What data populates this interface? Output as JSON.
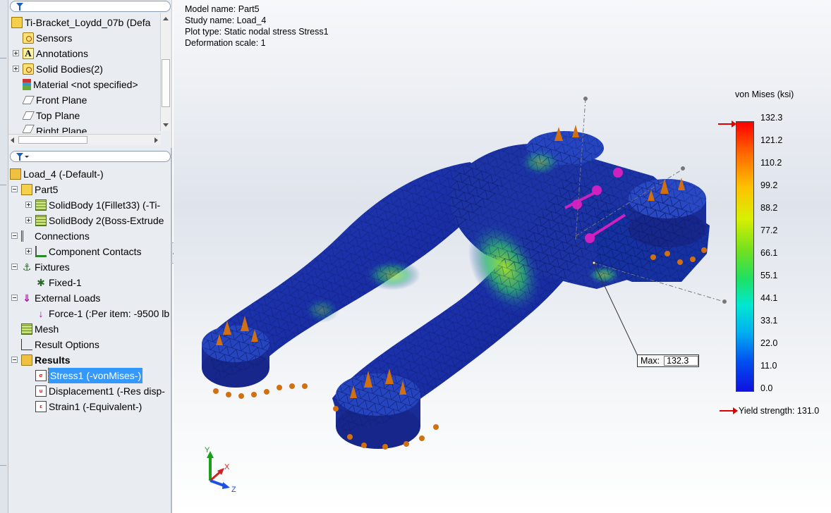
{
  "feature_tree": {
    "root_label": "Ti-Bracket_Loydd_07b  (Defa",
    "items": [
      {
        "label": "Sensors",
        "icon": "sensors-icon"
      },
      {
        "label": "Annotations",
        "icon": "annotations-icon"
      },
      {
        "label": "Solid Bodies(2)",
        "icon": "solid-bodies-icon"
      },
      {
        "label": "Material <not specified>",
        "icon": "material-icon"
      },
      {
        "label": "Front Plane",
        "icon": "plane-icon"
      },
      {
        "label": "Top Plane",
        "icon": "plane-icon"
      },
      {
        "label": "Right Plane",
        "icon": "plane-icon"
      }
    ]
  },
  "study_tree": {
    "root_label": "Load_4 (-Default-)",
    "part_label": "Part5",
    "solid_body_1": "SolidBody 1(Fillet33) (-Ti-",
    "solid_body_2": "SolidBody 2(Boss-Extrude",
    "connections": "Connections",
    "component_contacts": "Component Contacts",
    "fixtures": "Fixtures",
    "fixed_1": "Fixed-1",
    "external_loads": "External Loads",
    "force_1": "Force-1 (:Per item: -9500 lb",
    "mesh": "Mesh",
    "result_options": "Result Options",
    "results": "Results",
    "stress_1": "Stress1 (-vonMises-)",
    "displacement_1": "Displacement1 (-Res disp-",
    "strain_1": "Strain1 (-Equivalent-)"
  },
  "plot_info": {
    "model_name": "Model name: Part5",
    "study_name": "Study name: Load_4",
    "plot_type": "Plot type: Static nodal stress Stress1",
    "deformation_scale": "Deformation scale: 1"
  },
  "legend": {
    "title": "von Mises (ksi)",
    "ticks": [
      "132.3",
      "121.2",
      "110.2",
      "99.2",
      "88.2",
      "77.2",
      "66.1",
      "55.1",
      "44.1",
      "33.1",
      "22.0",
      "11.0",
      "0.0"
    ],
    "yield_label": "Yield strength: 131.0",
    "colors": {
      "max": "#ff0000",
      "min": "#1010e0",
      "marker": "#e00000"
    }
  },
  "max_annotation": {
    "key": "Max:",
    "value": "132.3"
  },
  "triad": {
    "x": "X",
    "y": "Y",
    "z": "Z"
  }
}
